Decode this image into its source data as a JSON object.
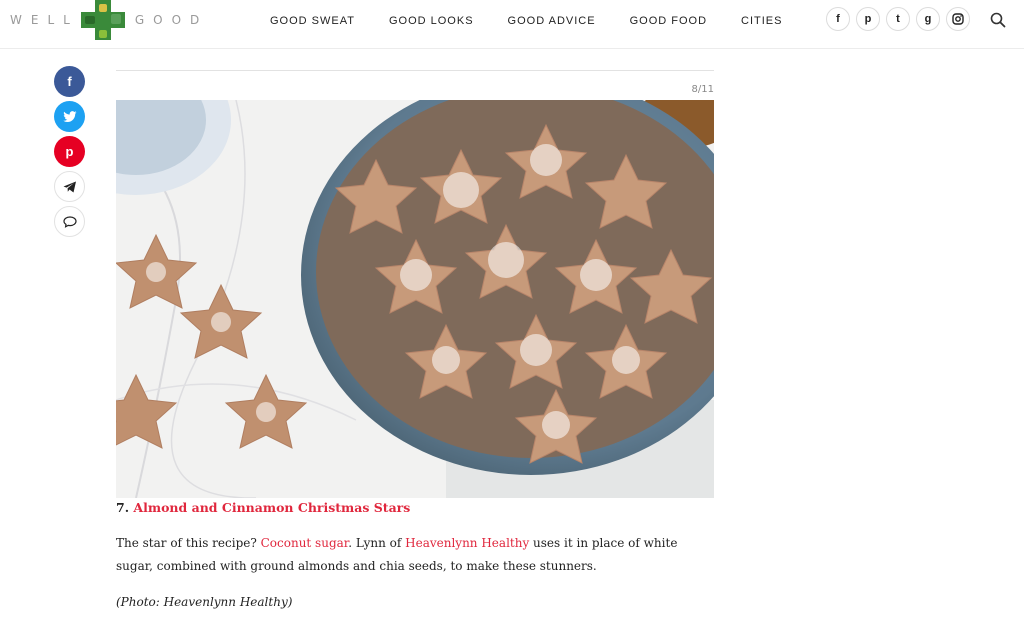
{
  "logo": {
    "left_word": "WELL",
    "right_word": "GOOD"
  },
  "nav": {
    "items": [
      "GOOD SWEAT",
      "GOOD LOOKS",
      "GOOD ADVICE",
      "GOOD FOOD",
      "CITIES"
    ]
  },
  "social_top": {
    "icons": [
      {
        "name": "facebook-icon",
        "glyph": "f"
      },
      {
        "name": "pinterest-icon",
        "glyph": "p"
      },
      {
        "name": "twitter-icon",
        "glyph": "t"
      },
      {
        "name": "google-plus-icon",
        "glyph": "g"
      },
      {
        "name": "instagram-icon",
        "glyph": "◘"
      }
    ]
  },
  "share_bar": {
    "facebook_glyph": "f",
    "twitter_glyph": "t",
    "pinterest_glyph": "p"
  },
  "slideshow": {
    "counter": "8/11"
  },
  "article": {
    "caption_number": "7.",
    "caption_link": "Almond and Cinnamon Christmas Stars",
    "para_prefix": "The star of this recipe? ",
    "para_link1": "Coconut sugar",
    "para_mid": ". Lynn of ",
    "para_link2": "Heavenlynn Healthy",
    "para_suffix": " uses it in place of white sugar, combined with ground almonds and chia seeds, to make these stunners.",
    "credit": "(Photo: Heavenlynn Healthy)"
  },
  "colors": {
    "accent": "#e0273d",
    "facebook": "#3b5998",
    "twitter": "#1da1f2",
    "pinterest": "#e60023"
  }
}
